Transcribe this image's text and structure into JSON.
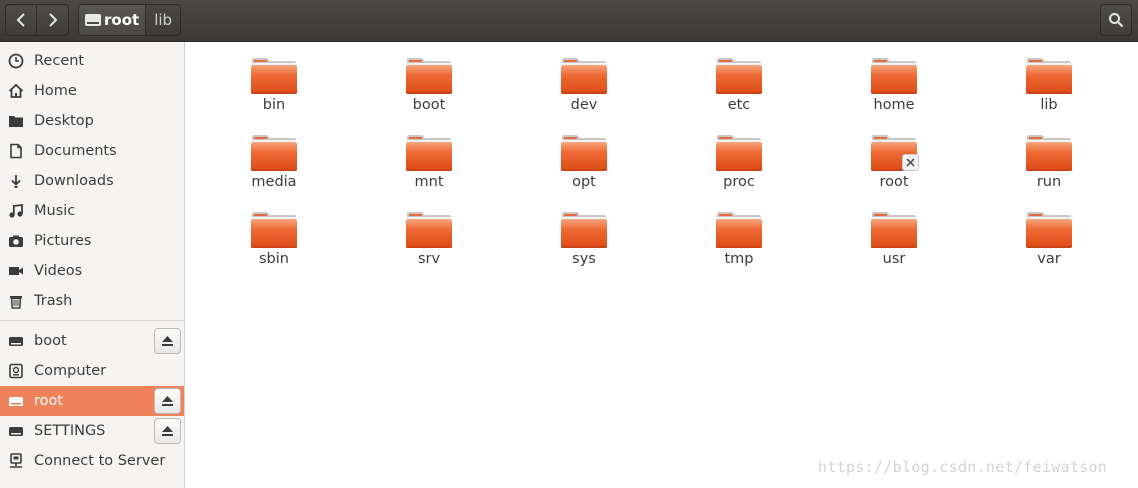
{
  "header": {
    "breadcrumbs": [
      "root",
      "lib"
    ]
  },
  "sidebar": {
    "places": [
      {
        "label": "Recent",
        "icon": "clock-icon"
      },
      {
        "label": "Home",
        "icon": "home-icon"
      },
      {
        "label": "Desktop",
        "icon": "desktop-folder-icon"
      },
      {
        "label": "Documents",
        "icon": "document-icon"
      },
      {
        "label": "Downloads",
        "icon": "download-icon"
      },
      {
        "label": "Music",
        "icon": "music-icon"
      },
      {
        "label": "Pictures",
        "icon": "camera-icon"
      },
      {
        "label": "Videos",
        "icon": "video-icon"
      },
      {
        "label": "Trash",
        "icon": "trash-icon"
      }
    ],
    "devices": [
      {
        "label": "boot",
        "icon": "drive-icon",
        "eject": true,
        "selected": false
      },
      {
        "label": "Computer",
        "icon": "computer-icon",
        "eject": false,
        "selected": false
      },
      {
        "label": "root",
        "icon": "drive-icon",
        "eject": true,
        "selected": true
      },
      {
        "label": "SETTINGS",
        "icon": "drive-icon",
        "eject": true,
        "selected": false
      },
      {
        "label": "Connect to Server",
        "icon": "server-icon",
        "eject": false,
        "selected": false
      }
    ]
  },
  "folders": [
    [
      "bin",
      "boot",
      "dev",
      "etc",
      "home",
      "lib"
    ],
    [
      "media",
      "mnt",
      "opt",
      "proc",
      "root",
      "run"
    ],
    [
      "sbin",
      "srv",
      "sys",
      "tmp",
      "usr",
      "var"
    ]
  ],
  "locked_folder": "root",
  "colors": {
    "selection": "#f0825a",
    "folder": "#e8541f",
    "header": "#3d3c39"
  },
  "watermark": "https://blog.csdn.net/feiwatson"
}
